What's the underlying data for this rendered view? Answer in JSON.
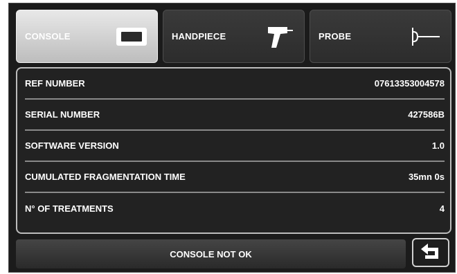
{
  "tabs": [
    {
      "label": "CONSOLE",
      "icon": "console-icon",
      "active": true
    },
    {
      "label": "HANDPIECE",
      "icon": "handpiece-icon",
      "active": false
    },
    {
      "label": "PROBE",
      "icon": "probe-icon",
      "active": false
    }
  ],
  "info": [
    {
      "label": "REF NUMBER",
      "value": "07613353004578"
    },
    {
      "label": "SERIAL NUMBER",
      "value": "427586B"
    },
    {
      "label": "SOFTWARE VERSION",
      "value": "1.0"
    },
    {
      "label": "CUMULATED FRAGMENTATION TIME",
      "value": "35mn 0s"
    },
    {
      "label": "N° OF TREATMENTS",
      "value": "4"
    }
  ],
  "status": {
    "text": "CONSOLE NOT OK"
  },
  "back_button": {
    "icon": "back-arrow-icon"
  },
  "colors": {
    "background": "#1b1b1b",
    "active_tab": "#d6d6d6",
    "text": "#ffffff"
  }
}
